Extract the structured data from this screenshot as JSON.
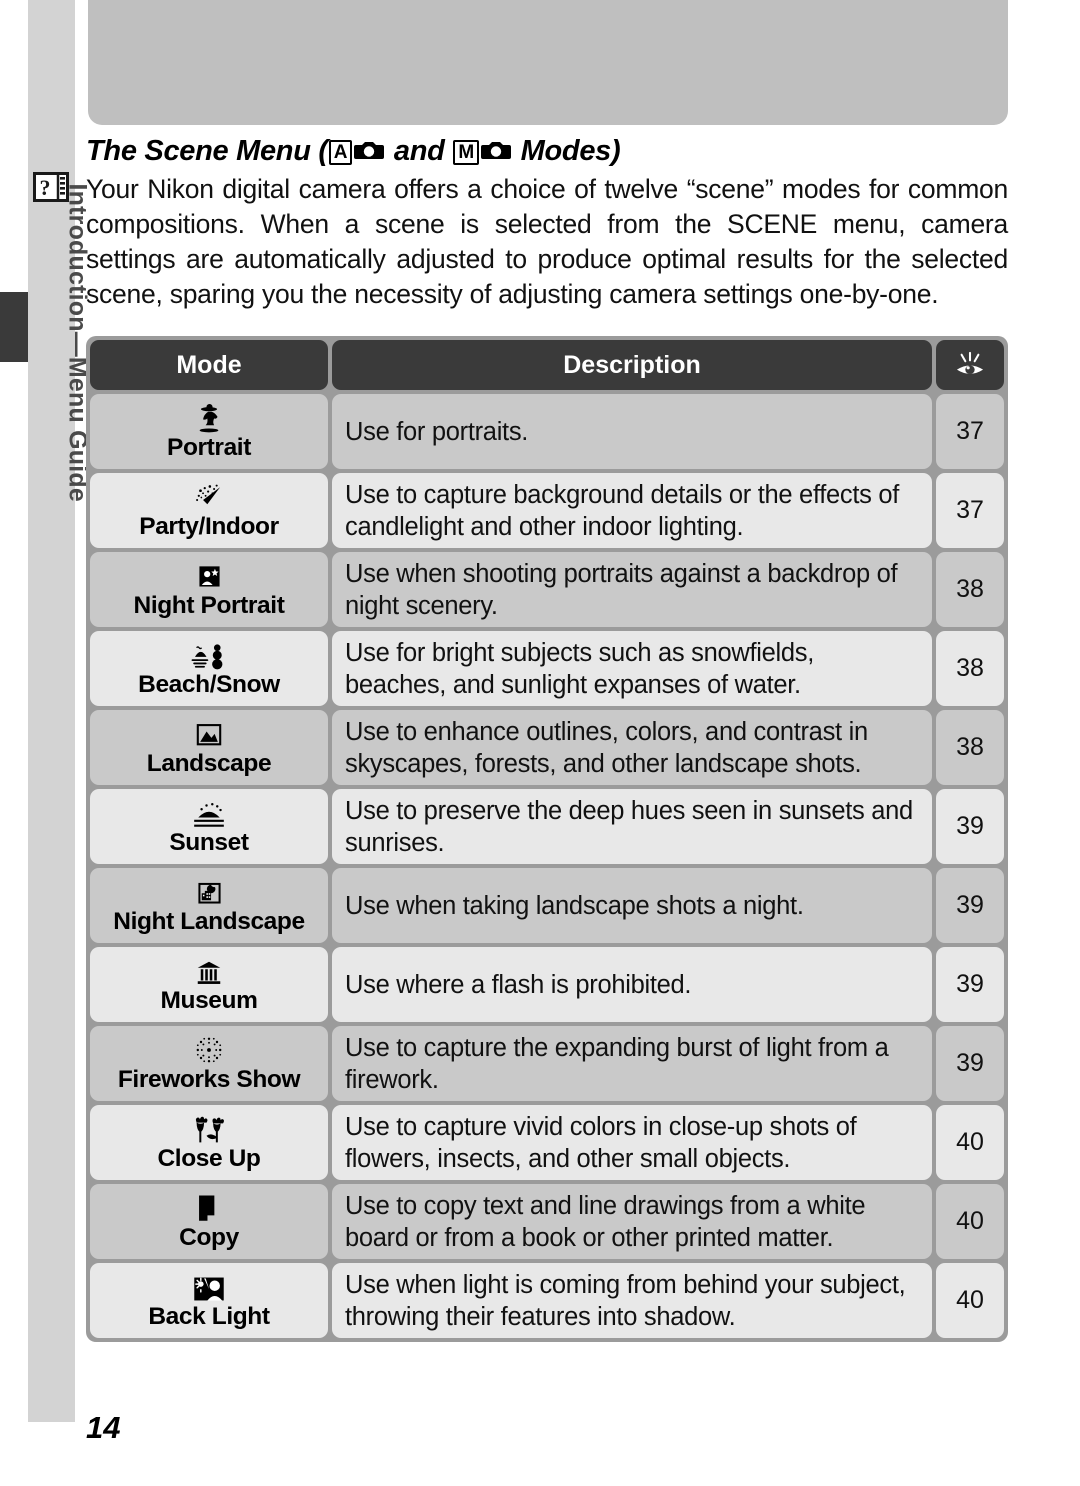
{
  "sidebar": {
    "label": "Introduction—Menu Guide",
    "icon": "question-book-icon",
    "tab_marker": "section-tab-marker"
  },
  "header_band": {
    "name": "top-decorative-band"
  },
  "title": {
    "before": "The Scene Menu (",
    "mode_a": "A",
    "and": " and ",
    "mode_m": "M",
    "after": " Modes)",
    "camera_icon": "camera-icon"
  },
  "intro_paragraph": "Your Nikon digital camera offers a choice of twelve “scene” modes for common compositions.  When a scene is selected from the SCENE menu, camera settings are automatically adjusted to produce optimal results for the selected scene, sparing you the necessity of adjusting camera settings one-by-one.",
  "table": {
    "headers": {
      "mode": "Mode",
      "description": "Description",
      "page": "eye-reference-icon"
    },
    "rows": [
      {
        "icon": "portrait-icon",
        "mode": "Portrait",
        "description": "Use for portraits.",
        "page": "37"
      },
      {
        "icon": "party-popper-icon",
        "mode": "Party/Indoor",
        "description": "Use to capture background details or the effects of candlelight and other indoor lighting.",
        "page": "37"
      },
      {
        "icon": "night-portrait-icon",
        "mode": "Night Portrait",
        "description": "Use when shooting portraits against a backdrop of night scenery.",
        "page": "38"
      },
      {
        "icon": "beach-snow-icon",
        "mode": "Beach/Snow",
        "description": "Use for bright subjects such as snowfields, beaches, and sunlight expanses of water.",
        "page": "38"
      },
      {
        "icon": "landscape-icon",
        "mode": "Landscape",
        "description": "Use to enhance outlines, colors, and contrast in skyscapes, forests, and other landscape shots.",
        "page": "38"
      },
      {
        "icon": "sunset-icon",
        "mode": "Sunset",
        "description": "Use to preserve the deep hues seen in sunsets and sunrises.",
        "page": "39"
      },
      {
        "icon": "night-landscape-icon",
        "mode": "Night Landscape",
        "description": "Use when taking landscape shots a night.",
        "page": "39"
      },
      {
        "icon": "museum-icon",
        "mode": "Museum",
        "description": "Use where a flash is prohibited.",
        "page": "39"
      },
      {
        "icon": "fireworks-icon",
        "mode": "Fireworks Show",
        "description": "Use to capture the expanding burst of light from a firework.",
        "page": "39"
      },
      {
        "icon": "close-up-icon",
        "mode": "Close Up",
        "description": "Use to capture vivid colors in close-up shots of flowers, insects, and other small objects.",
        "page": "40"
      },
      {
        "icon": "copy-icon",
        "mode": "Copy",
        "description": "Use to copy text and line drawings from a white board or from a book or other printed matter.",
        "page": "40"
      },
      {
        "icon": "back-light-icon",
        "mode": "Back Light",
        "description": "Use when light is coming from behind your subject, throwing their features into shadow.",
        "page": "40"
      }
    ]
  },
  "footer": {
    "page_number": "14"
  },
  "colors": {
    "header_row": "#3a3a3a",
    "row_dark": "#c9c9c9",
    "row_light": "#e8e8e8",
    "table_border": "#9b9b9b",
    "sidebar": "#d3d3d3",
    "band": "#bfbfbf"
  }
}
